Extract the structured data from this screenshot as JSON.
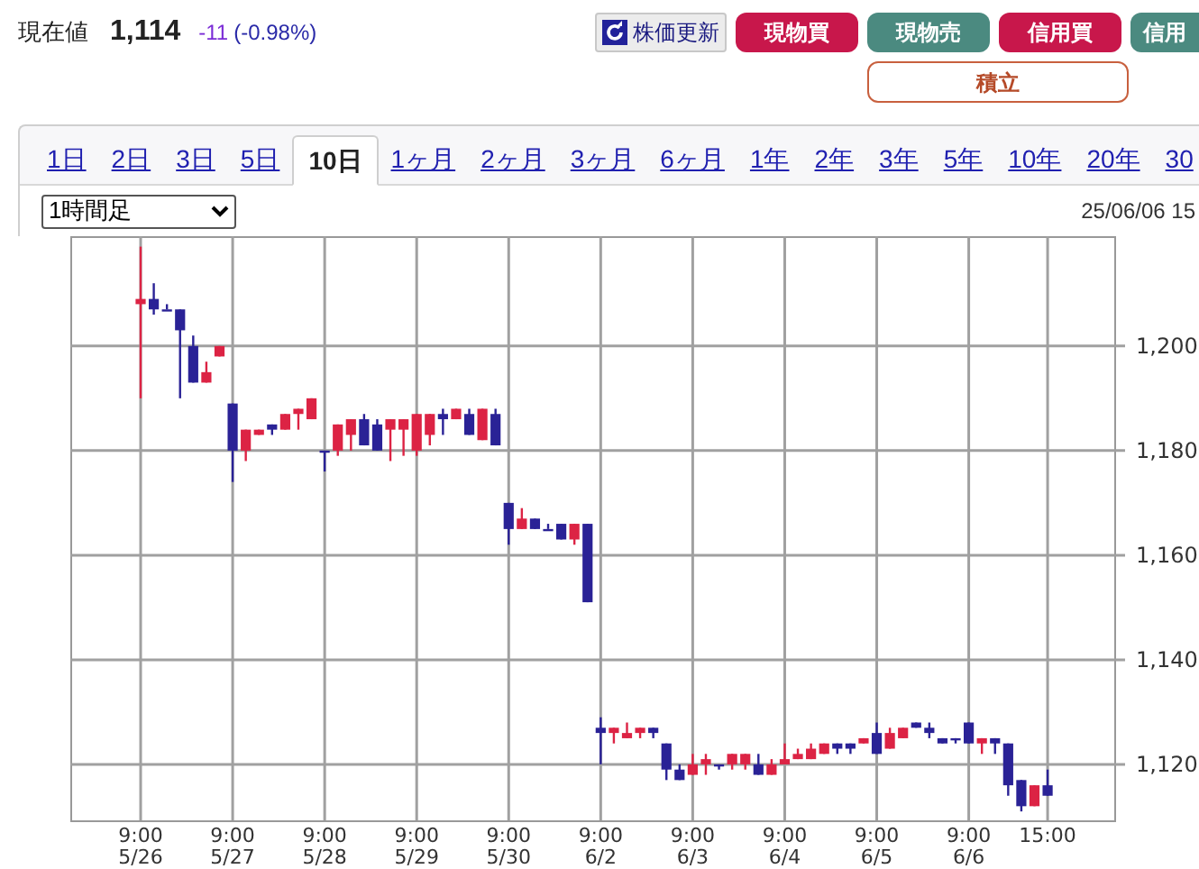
{
  "quote": {
    "label": "現在値",
    "price": "1,114",
    "change": "-11",
    "change_pct": "(-0.98%)"
  },
  "actions": [
    {
      "label": "株価更新",
      "kind": "refresh"
    },
    {
      "label": "現物買",
      "kind": "buy"
    },
    {
      "label": "現物売",
      "kind": "sell"
    },
    {
      "label": "信用買",
      "kind": "buy"
    },
    {
      "label": "信用",
      "kind": "sell"
    }
  ],
  "accumulate_button": {
    "label": "積立"
  },
  "period_tabs": [
    {
      "label": "1日",
      "selected": false
    },
    {
      "label": "2日",
      "selected": false
    },
    {
      "label": "3日",
      "selected": false
    },
    {
      "label": "5日",
      "selected": false
    },
    {
      "label": "10日",
      "selected": true
    },
    {
      "label": "1ヶ月",
      "selected": false
    },
    {
      "label": "2ヶ月",
      "selected": false
    },
    {
      "label": "3ヶ月",
      "selected": false
    },
    {
      "label": "6ヶ月",
      "selected": false
    },
    {
      "label": "1年",
      "selected": false
    },
    {
      "label": "2年",
      "selected": false
    },
    {
      "label": "3年",
      "selected": false
    },
    {
      "label": "5年",
      "selected": false
    },
    {
      "label": "10年",
      "selected": false
    },
    {
      "label": "20年",
      "selected": false
    },
    {
      "label": "30",
      "selected": false
    }
  ],
  "interval_select": {
    "value": "1時間足"
  },
  "timestamp": "25/06/06 15",
  "chart": {
    "chart_data": {
      "type": "candlestick",
      "categories": [
        "9:00\n5/26",
        null,
        null,
        null,
        null,
        null,
        null,
        "9:00\n5/27",
        null,
        null,
        null,
        null,
        null,
        null,
        "9:00\n5/28",
        null,
        null,
        null,
        null,
        null,
        null,
        "9:00\n5/29",
        null,
        null,
        null,
        null,
        null,
        null,
        "9:00\n5/30",
        null,
        null,
        null,
        null,
        null,
        null,
        "9:00\n6/2",
        null,
        null,
        null,
        null,
        null,
        null,
        "9:00\n6/3",
        null,
        null,
        null,
        null,
        null,
        null,
        "9:00\n6/4",
        null,
        null,
        null,
        null,
        null,
        null,
        "9:00\n6/5",
        null,
        null,
        null,
        null,
        null,
        null,
        "9:00\n6/6",
        null,
        null,
        null,
        null,
        null,
        "15:00"
      ],
      "ohlc": [
        [
          1208,
          1219,
          1190,
          1209
        ],
        [
          1209,
          1212,
          1206,
          1207
        ],
        [
          1207,
          1208,
          1207,
          1207
        ],
        [
          1207,
          1207,
          1190,
          1203
        ],
        [
          1200,
          1202,
          1193,
          1193
        ],
        [
          1193,
          1197,
          1193,
          1195
        ],
        [
          1198,
          1200,
          1198,
          1200
        ],
        [
          1189,
          1189,
          1174,
          1180
        ],
        [
          1180,
          1184,
          1178,
          1184
        ],
        [
          1183,
          1184,
          1183,
          1184
        ],
        [
          1185,
          1185,
          1183,
          1184
        ],
        [
          1184,
          1187,
          1184,
          1187
        ],
        [
          1187,
          1188,
          1184,
          1188
        ],
        [
          1186,
          1190,
          1186,
          1190
        ],
        [
          1180,
          1180,
          1176,
          1180
        ],
        [
          1180,
          1185,
          1179,
          1185
        ],
        [
          1183,
          1186,
          1180,
          1186
        ],
        [
          1186,
          1187,
          1181,
          1181
        ],
        [
          1185,
          1186,
          1180,
          1180
        ],
        [
          1184,
          1186,
          1178,
          1186
        ],
        [
          1184,
          1186,
          1179,
          1186
        ],
        [
          1180,
          1187,
          1179,
          1187
        ],
        [
          1183,
          1187,
          1181,
          1187
        ],
        [
          1187,
          1188,
          1183,
          1186
        ],
        [
          1186,
          1188,
          1186,
          1188
        ],
        [
          1187,
          1188,
          1183,
          1183
        ],
        [
          1182,
          1188,
          1182,
          1188
        ],
        [
          1187,
          1188,
          1181,
          1181
        ],
        [
          1170,
          1170,
          1162,
          1165
        ],
        [
          1165,
          1169,
          1165,
          1167
        ],
        [
          1167,
          1167,
          1165,
          1165
        ],
        [
          1165,
          1166,
          1165,
          1165
        ],
        [
          1166,
          1166,
          1163,
          1163
        ],
        [
          1163,
          1166,
          1162,
          1166
        ],
        [
          1166,
          1166,
          1151,
          1151
        ],
        [
          1127,
          1129,
          1120,
          1126
        ],
        [
          1126,
          1127,
          1124,
          1127
        ],
        [
          1125,
          1128,
          1125,
          1126
        ],
        [
          1126,
          1127,
          1125,
          1127
        ],
        [
          1127,
          1127,
          1125,
          1126
        ],
        [
          1124,
          1124,
          1117,
          1119
        ],
        [
          1119,
          1120,
          1117,
          1117
        ],
        [
          1118,
          1122,
          1118,
          1120
        ],
        [
          1120,
          1122,
          1118,
          1121
        ],
        [
          1120,
          1120,
          1119,
          1120
        ],
        [
          1120,
          1122,
          1119,
          1122
        ],
        [
          1120,
          1122,
          1119,
          1122
        ],
        [
          1120,
          1122,
          1118,
          1118
        ],
        [
          1118,
          1121,
          1118,
          1120
        ],
        [
          1120,
          1124,
          1120,
          1121
        ],
        [
          1121,
          1123,
          1121,
          1122
        ],
        [
          1121,
          1124,
          1121,
          1123
        ],
        [
          1122,
          1124,
          1122,
          1124
        ],
        [
          1124,
          1124,
          1122,
          1123
        ],
        [
          1124,
          1124,
          1122,
          1123
        ],
        [
          1124,
          1125,
          1124,
          1125
        ],
        [
          1126,
          1128,
          1122,
          1122
        ],
        [
          1123,
          1127,
          1123,
          1126
        ],
        [
          1125,
          1127,
          1125,
          1127
        ],
        [
          1128,
          1128,
          1127,
          1127
        ],
        [
          1127,
          1128,
          1125,
          1126
        ],
        [
          1125,
          1125,
          1124,
          1124
        ],
        [
          1125,
          1125,
          1124,
          1125
        ],
        [
          1128,
          1128,
          1124,
          1124
        ],
        [
          1124,
          1125,
          1122,
          1125
        ],
        [
          1125,
          1125,
          1122,
          1124
        ],
        [
          1124,
          1124,
          1114,
          1116
        ],
        [
          1117,
          1117,
          1111,
          1112
        ],
        [
          1112,
          1116,
          1112,
          1116
        ],
        [
          1116,
          1119,
          1114,
          1114
        ]
      ],
      "ylim": [
        1109.3,
        1221
      ],
      "grid": true,
      "yticks": [
        {
          "value": 1200,
          "label": "1,200"
        },
        {
          "value": 1180,
          "label": "1,180"
        },
        {
          "value": 1160,
          "label": "1,160"
        },
        {
          "value": 1140,
          "label": "1,140"
        },
        {
          "value": 1120,
          "label": "1,120"
        }
      ]
    }
  }
}
